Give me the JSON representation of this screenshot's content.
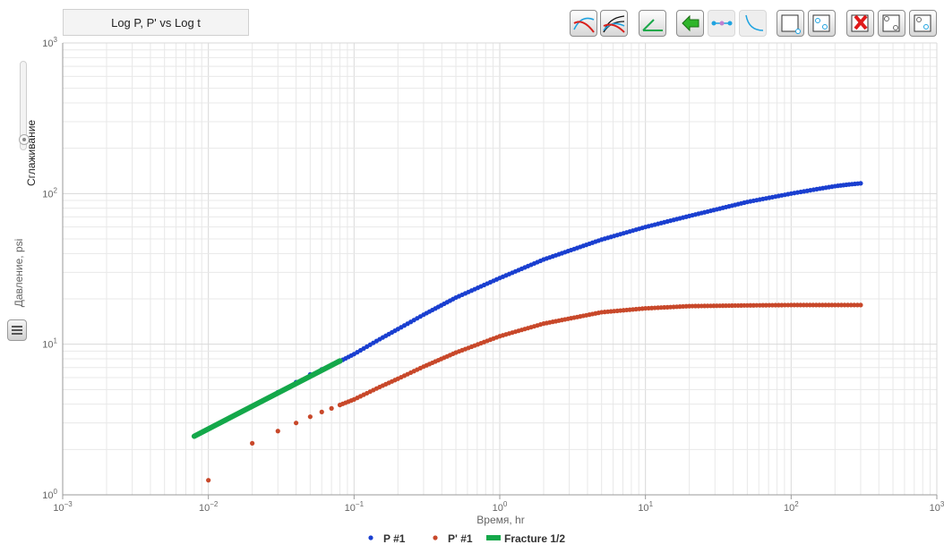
{
  "header": {
    "title": "Log P, P' vs Log t"
  },
  "toolbar": {
    "buttons": [
      {
        "name": "plot-curve-red-blue-button"
      },
      {
        "name": "plot-multi-curve-button"
      },
      {
        "name": "plot-green-line-button"
      },
      {
        "name": "back-arrow-button"
      },
      {
        "name": "points-line-button"
      },
      {
        "name": "decline-curve-button"
      },
      {
        "name": "select-region-button"
      },
      {
        "name": "select-points-button"
      },
      {
        "name": "delete-points-button"
      },
      {
        "name": "zoom-region-button"
      },
      {
        "name": "reset-zoom-button"
      }
    ]
  },
  "side": {
    "smoothing_label": "Сглаживание",
    "smoothing_level": 0.12
  },
  "chart_data": {
    "type": "scatter",
    "x_scale": "log",
    "y_scale": "log",
    "xlim": [
      0.001,
      1000
    ],
    "ylim": [
      1,
      1000
    ],
    "xlabel": "Время, hr",
    "ylabel": "Давление, psi",
    "x_ticks": [
      {
        "value": 0.001,
        "base": "10",
        "exp": "−3"
      },
      {
        "value": 0.01,
        "base": "10",
        "exp": "−2"
      },
      {
        "value": 0.1,
        "base": "10",
        "exp": "−1"
      },
      {
        "value": 1,
        "base": "10",
        "exp": "0"
      },
      {
        "value": 10,
        "base": "10",
        "exp": "1"
      },
      {
        "value": 100,
        "base": "10",
        "exp": "2"
      },
      {
        "value": 1000,
        "base": "10",
        "exp": "3"
      }
    ],
    "y_ticks": [
      {
        "value": 1,
        "base": "10",
        "exp": "0"
      },
      {
        "value": 10,
        "base": "10",
        "exp": "1"
      },
      {
        "value": 100,
        "base": "10",
        "exp": "2"
      },
      {
        "value": 1000,
        "base": "10",
        "exp": "3"
      }
    ],
    "grid": true,
    "legend": "bottom-center",
    "series": [
      {
        "name": "P #1",
        "color": "#1a3fd0",
        "style": "points",
        "x": [
          0.03,
          0.04,
          0.05,
          0.06,
          0.07,
          0.08,
          0.1,
          0.15,
          0.2,
          0.3,
          0.5,
          1,
          2,
          5,
          10,
          20,
          50,
          100,
          150,
          200,
          250,
          300
        ],
        "y": [
          4.8,
          5.6,
          6.3,
          6.8,
          7.3,
          7.7,
          8.6,
          10.8,
          12.6,
          15.7,
          20.4,
          27.5,
          36.5,
          49.5,
          60,
          71,
          88,
          100,
          107,
          112,
          115,
          117
        ]
      },
      {
        "name": "P' #1",
        "color": "#c8482a",
        "style": "points",
        "x": [
          0.01,
          0.02,
          0.03,
          0.04,
          0.05,
          0.06,
          0.07,
          0.08,
          0.1,
          0.15,
          0.2,
          0.3,
          0.5,
          1,
          2,
          5,
          10,
          20,
          50,
          100,
          200,
          300
        ],
        "y": [
          1.25,
          2.2,
          2.65,
          3.0,
          3.3,
          3.55,
          3.75,
          3.95,
          4.3,
          5.2,
          5.9,
          7.1,
          8.8,
          11.3,
          13.7,
          16.3,
          17.3,
          17.9,
          18.1,
          18.2,
          18.2,
          18.2
        ]
      },
      {
        "name": "Fracture 1/2",
        "color": "#14a84a",
        "style": "line",
        "x": [
          0.008,
          0.08
        ],
        "y": [
          2.45,
          7.75
        ]
      }
    ]
  }
}
